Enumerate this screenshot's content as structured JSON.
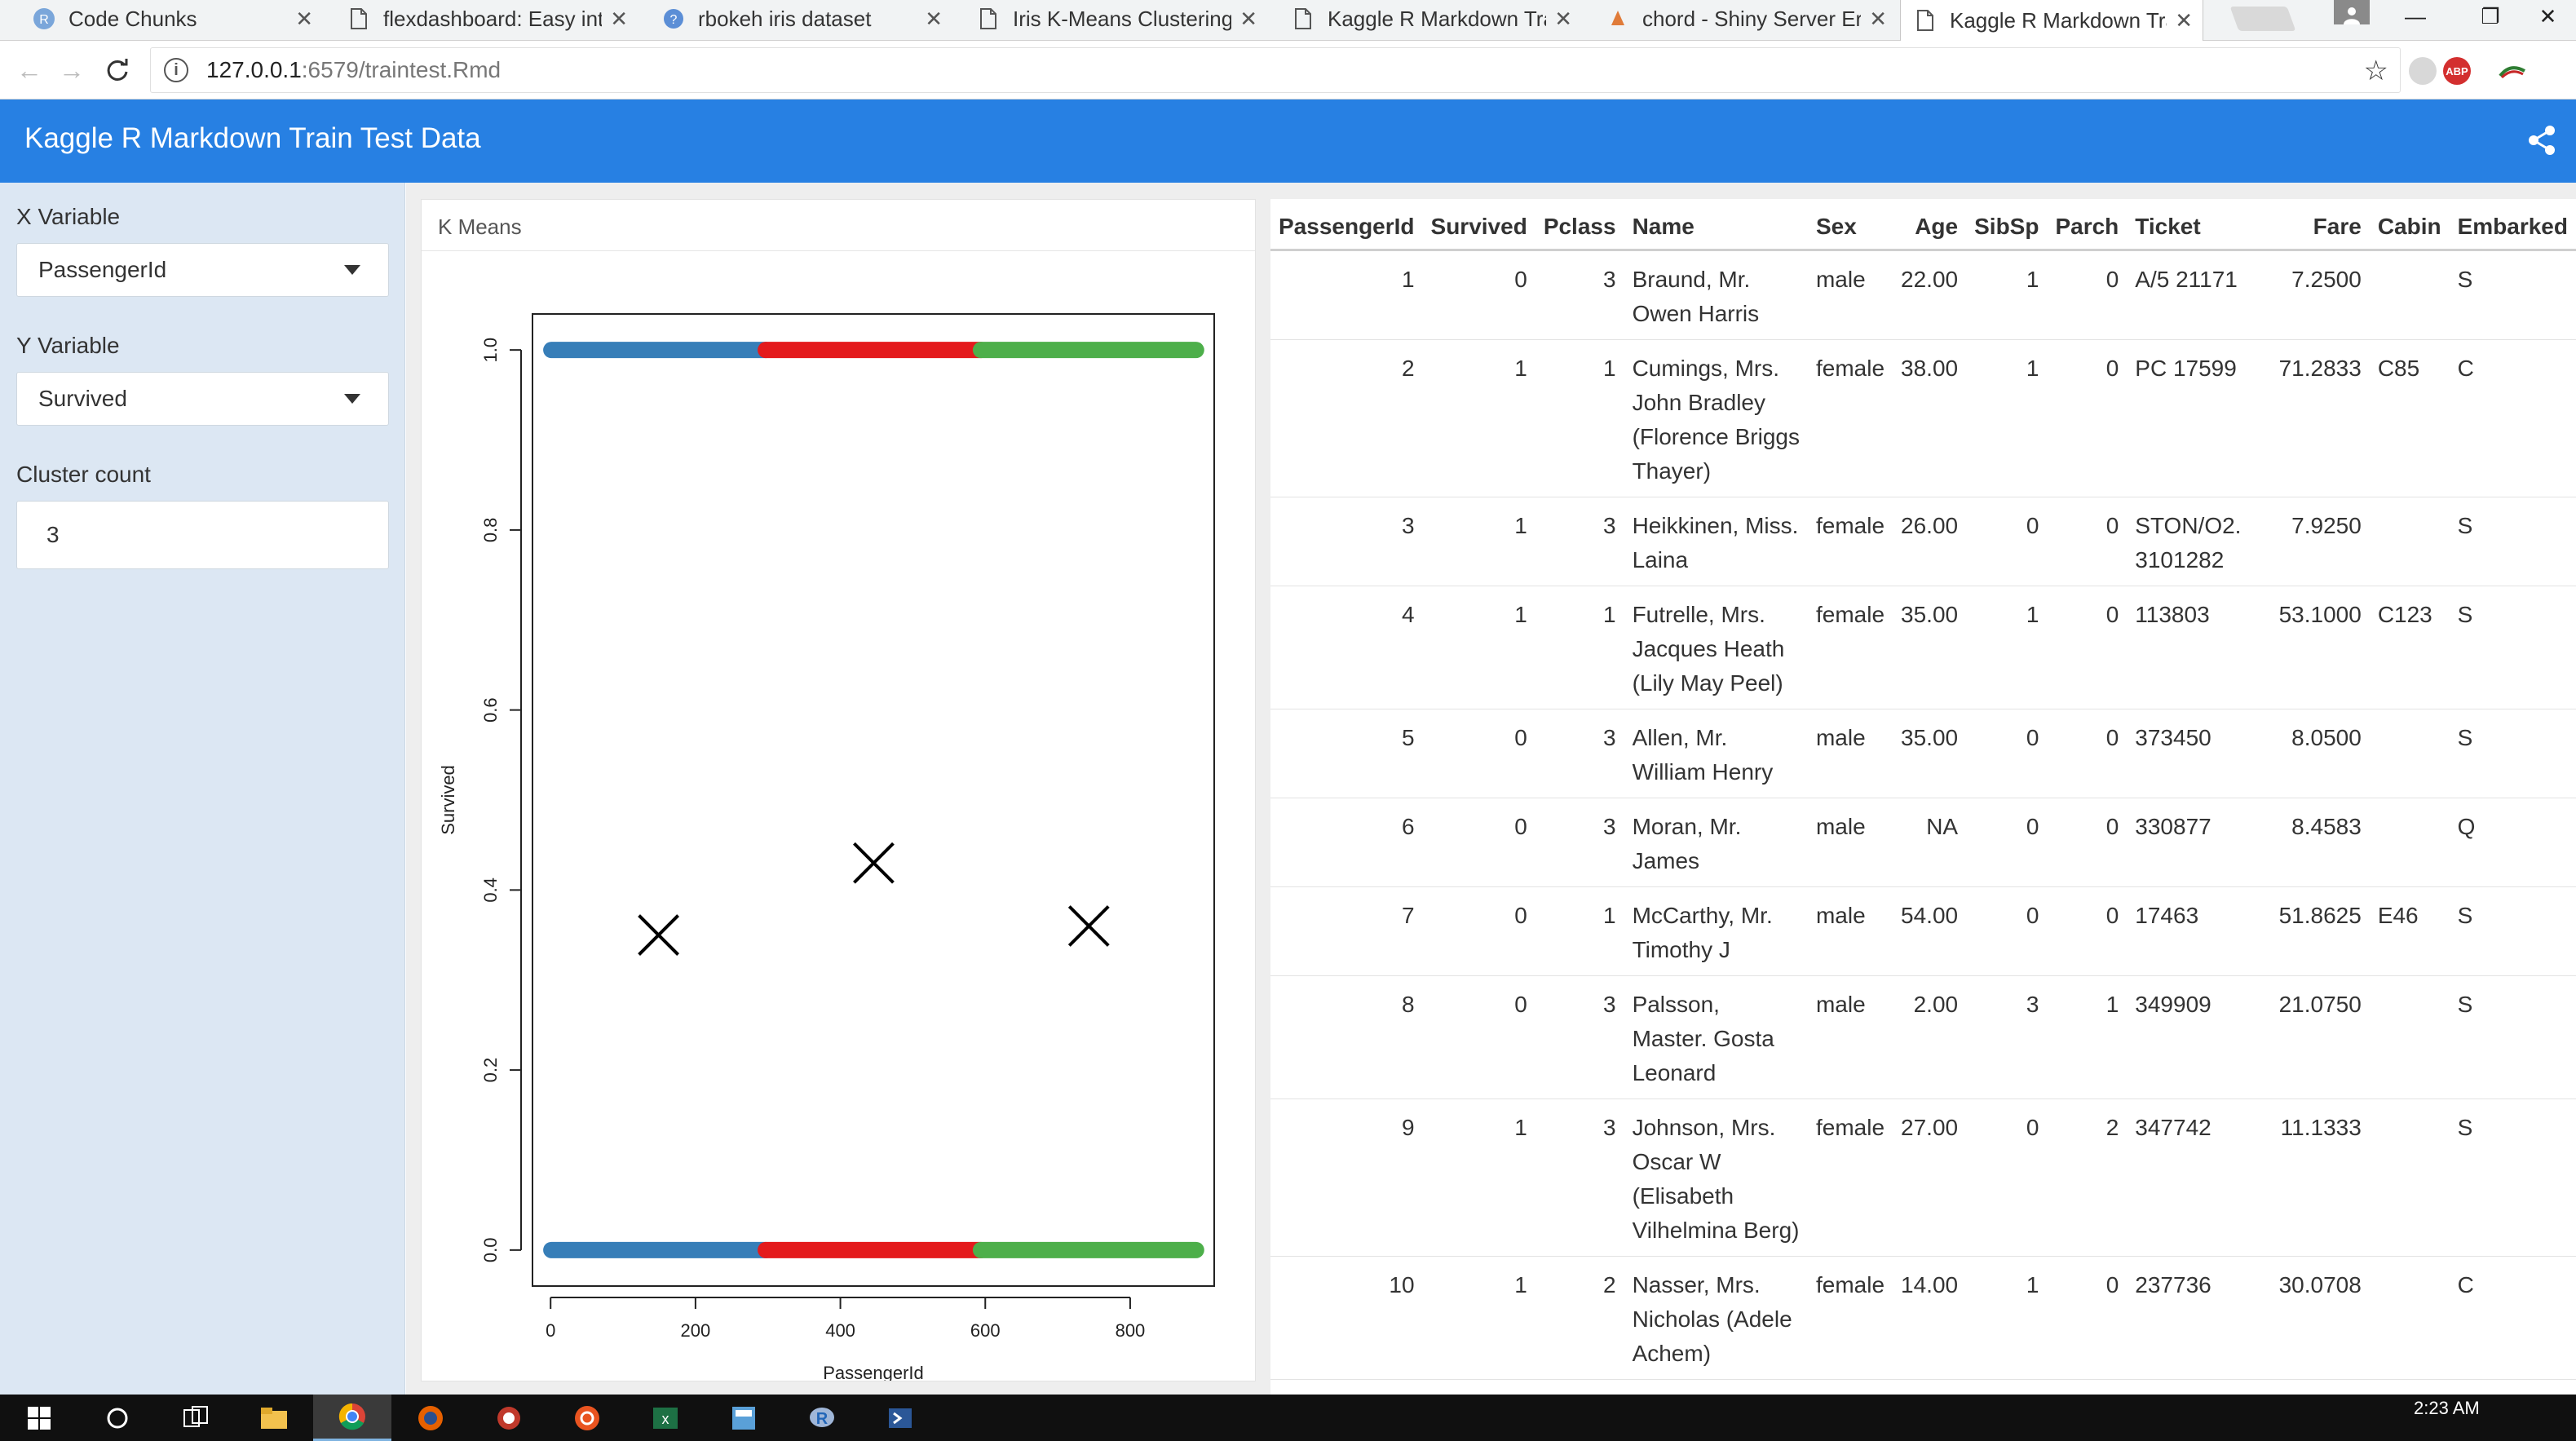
{
  "browser": {
    "tabs": [
      {
        "title": "Code Chunks",
        "icon": "r-icon"
      },
      {
        "title": "flexdashboard: Easy inter",
        "icon": "page-icon"
      },
      {
        "title": "rbokeh iris dataset",
        "icon": "globe-icon"
      },
      {
        "title": "Iris K-Means Clustering",
        "icon": "page-icon"
      },
      {
        "title": "Kaggle R Markdown Trai",
        "icon": "page-icon"
      },
      {
        "title": "chord - Shiny Server Erro",
        "icon": "shiny-icon"
      },
      {
        "title": "Kaggle R Markdown Trai",
        "icon": "page-icon",
        "active": true
      }
    ],
    "url_host": "127.0.0.1",
    "url_path": ":6579/traintest.Rmd",
    "ext_abp": "ABP"
  },
  "app": {
    "title": "Kaggle R Markdown Train Test Data",
    "accent": "#2780e3",
    "sidebar_bg": "#dce7f3"
  },
  "sidebar": {
    "x_label": "X Variable",
    "x_value": "PassengerId",
    "y_label": "Y Variable",
    "y_value": "Survived",
    "k_label": "Cluster count",
    "k_value": "3"
  },
  "chart_card": {
    "title": "K Means"
  },
  "chart_data": {
    "type": "scatter",
    "title": "",
    "xlabel": "PassengerId",
    "ylabel": "Survived",
    "xlim": [
      -25,
      916
    ],
    "ylim": [
      -0.04,
      1.04
    ],
    "xticks": [
      0,
      200,
      400,
      600,
      800
    ],
    "yticks": [
      "0.0",
      "0.2",
      "0.4",
      "0.6",
      "0.8",
      "1.0"
    ],
    "clusters": [
      {
        "color": "#377eb8",
        "x_range": [
          1,
          297
        ]
      },
      {
        "color": "#e41a1c",
        "x_range": [
          297,
          594
        ]
      },
      {
        "color": "#4daf4a",
        "x_range": [
          594,
          891
        ]
      }
    ],
    "y_values": [
      0,
      1
    ],
    "centers": [
      {
        "x": 149,
        "y": 0.35
      },
      {
        "x": 446,
        "y": 0.43
      },
      {
        "x": 743,
        "y": 0.36
      }
    ]
  },
  "table": {
    "columns": [
      "PassengerId",
      "Survived",
      "Pclass",
      "Name",
      "Sex",
      "Age",
      "SibSp",
      "Parch",
      "Ticket",
      "Fare",
      "Cabin",
      "Embarked"
    ],
    "rows": [
      {
        "id": "1",
        "survived": "0",
        "pclass": "3",
        "name": "Braund, Mr. Owen Harris",
        "sex": "male",
        "age": "22.00",
        "sibsp": "1",
        "parch": "0",
        "ticket": "A/5 21171",
        "fare": "7.2500",
        "cabin": "",
        "embarked": "S"
      },
      {
        "id": "2",
        "survived": "1",
        "pclass": "1",
        "name": "Cumings, Mrs. John Bradley (Florence Briggs Thayer)",
        "sex": "female",
        "age": "38.00",
        "sibsp": "1",
        "parch": "0",
        "ticket": "PC 17599",
        "fare": "71.2833",
        "cabin": "C85",
        "embarked": "C"
      },
      {
        "id": "3",
        "survived": "1",
        "pclass": "3",
        "name": "Heikkinen, Miss. Laina",
        "sex": "female",
        "age": "26.00",
        "sibsp": "0",
        "parch": "0",
        "ticket": "STON/O2. 3101282",
        "fare": "7.9250",
        "cabin": "",
        "embarked": "S"
      },
      {
        "id": "4",
        "survived": "1",
        "pclass": "1",
        "name": "Futrelle, Mrs. Jacques Heath (Lily May Peel)",
        "sex": "female",
        "age": "35.00",
        "sibsp": "1",
        "parch": "0",
        "ticket": "113803",
        "fare": "53.1000",
        "cabin": "C123",
        "embarked": "S"
      },
      {
        "id": "5",
        "survived": "0",
        "pclass": "3",
        "name": "Allen, Mr. William Henry",
        "sex": "male",
        "age": "35.00",
        "sibsp": "0",
        "parch": "0",
        "ticket": "373450",
        "fare": "8.0500",
        "cabin": "",
        "embarked": "S"
      },
      {
        "id": "6",
        "survived": "0",
        "pclass": "3",
        "name": "Moran, Mr. James",
        "sex": "male",
        "age": "NA",
        "sibsp": "0",
        "parch": "0",
        "ticket": "330877",
        "fare": "8.4583",
        "cabin": "",
        "embarked": "Q"
      },
      {
        "id": "7",
        "survived": "0",
        "pclass": "1",
        "name": "McCarthy, Mr. Timothy J",
        "sex": "male",
        "age": "54.00",
        "sibsp": "0",
        "parch": "0",
        "ticket": "17463",
        "fare": "51.8625",
        "cabin": "E46",
        "embarked": "S"
      },
      {
        "id": "8",
        "survived": "0",
        "pclass": "3",
        "name": "Palsson, Master. Gosta Leonard",
        "sex": "male",
        "age": "2.00",
        "sibsp": "3",
        "parch": "1",
        "ticket": "349909",
        "fare": "21.0750",
        "cabin": "",
        "embarked": "S"
      },
      {
        "id": "9",
        "survived": "1",
        "pclass": "3",
        "name": "Johnson, Mrs. Oscar W (Elisabeth Vilhelmina Berg)",
        "sex": "female",
        "age": "27.00",
        "sibsp": "0",
        "parch": "2",
        "ticket": "347742",
        "fare": "11.1333",
        "cabin": "",
        "embarked": "S"
      },
      {
        "id": "10",
        "survived": "1",
        "pclass": "2",
        "name": "Nasser, Mrs. Nicholas (Adele Achem)",
        "sex": "female",
        "age": "14.00",
        "sibsp": "1",
        "parch": "0",
        "ticket": "237736",
        "fare": "30.0708",
        "cabin": "",
        "embarked": "C"
      }
    ]
  },
  "taskbar": {
    "apps": [
      "windows-start-icon",
      "cortana-icon",
      "task-view-icon",
      "file-explorer-icon",
      "chrome-icon",
      "firefox-icon",
      "app-icon",
      "ubuntu-icon",
      "excel-icon",
      "calculator-icon",
      "r-icon",
      "powershell-icon"
    ],
    "time": "2:23 AM"
  }
}
